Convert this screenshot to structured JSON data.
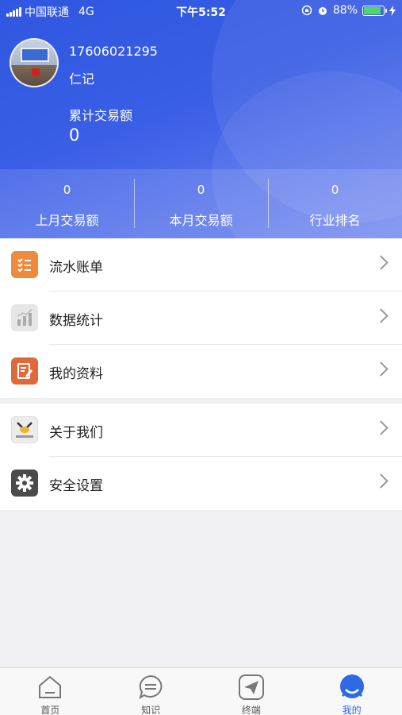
{
  "status_bar": {
    "carrier": "中国联通",
    "network": "4G",
    "time": "下午5:52",
    "battery": "88%",
    "battery_level": 0.88,
    "battery_color": "#4cd964"
  },
  "profile": {
    "phone": "17606021295",
    "name": "仁记",
    "total_label": "累计交易额",
    "total_value": "0"
  },
  "stats": [
    {
      "value": "0",
      "label": "上月交易额"
    },
    {
      "value": "0",
      "label": "本月交易额"
    },
    {
      "value": "0",
      "label": "行业排名"
    }
  ],
  "menu_groups": [
    [
      {
        "label": "流水账单",
        "icon": "bill-list-icon"
      },
      {
        "label": "数据统计",
        "icon": "bar-chart-icon"
      },
      {
        "label": "我的资料",
        "icon": "profile-edit-icon"
      }
    ],
    [
      {
        "label": "关于我们",
        "icon": "company-logo-icon"
      },
      {
        "label": "安全设置",
        "icon": "gear-icon"
      }
    ]
  ],
  "tabs": [
    {
      "label": "首页",
      "icon": "home-icon",
      "active": false
    },
    {
      "label": "知识",
      "icon": "message-icon",
      "active": false
    },
    {
      "label": "终端",
      "icon": "send-icon",
      "active": false
    },
    {
      "label": "我的",
      "icon": "user-icon",
      "active": true
    }
  ],
  "colors": {
    "header_primary": "#2f57e0",
    "header_secondary": "#6f86ef",
    "active_tab": "#2f6ae6"
  }
}
